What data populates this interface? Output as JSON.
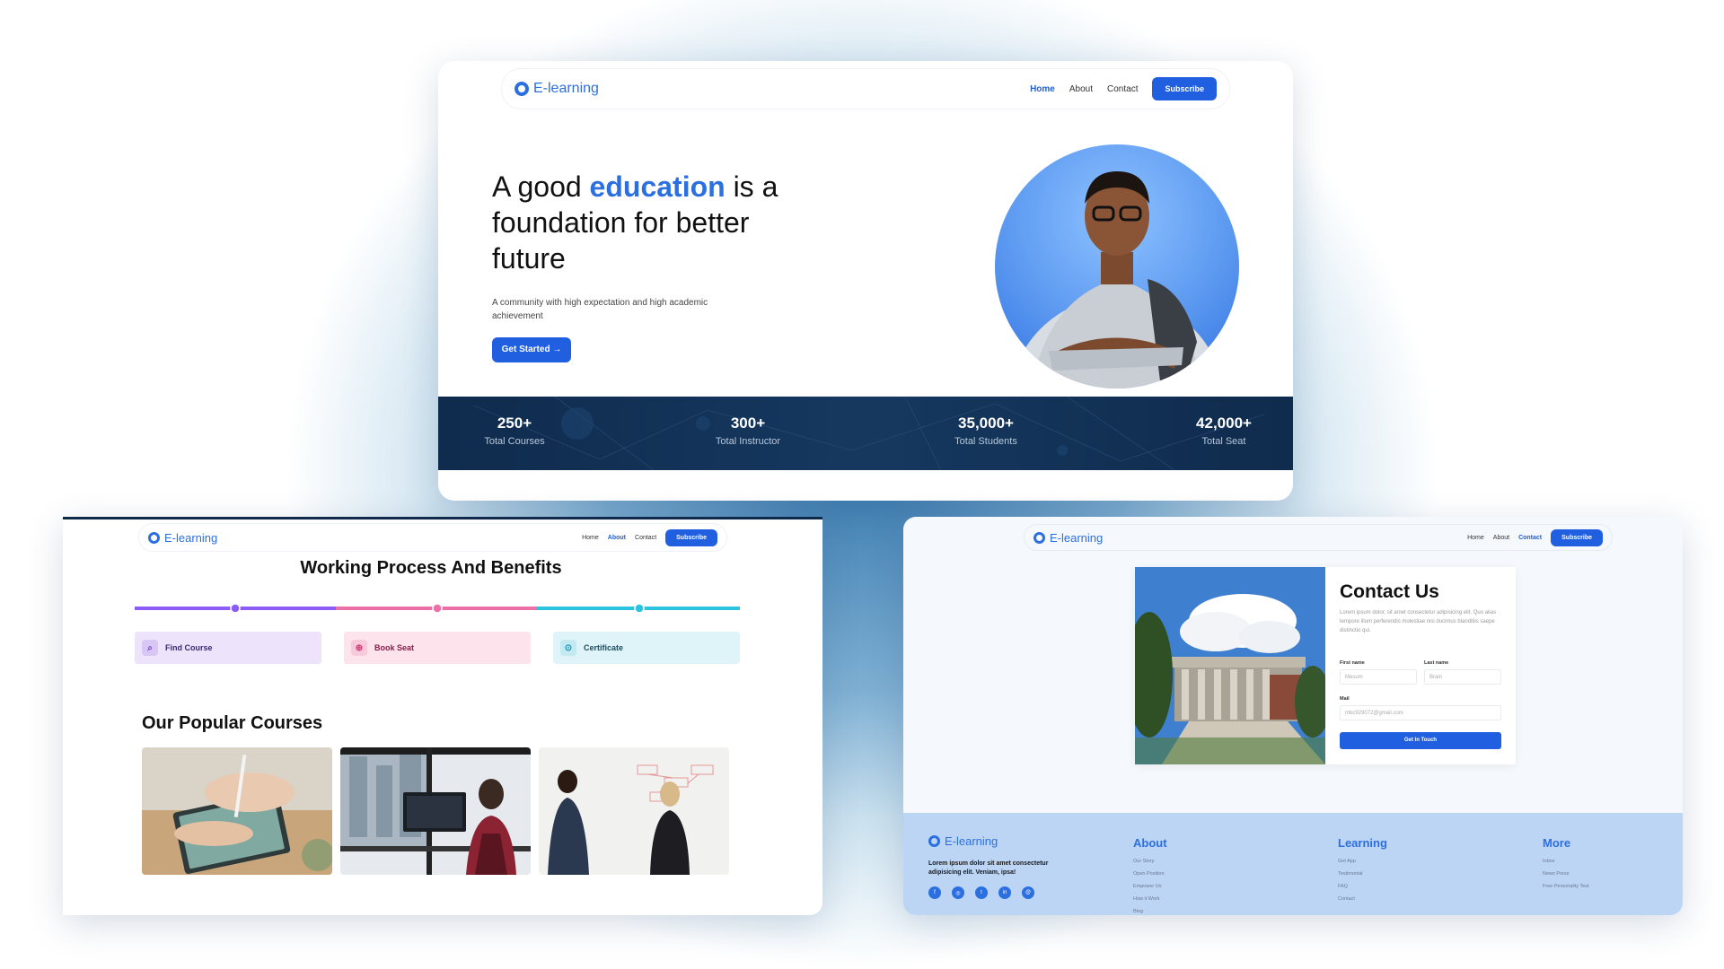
{
  "brand": "E-learning",
  "colors": {
    "accent": "#1f5fe0",
    "stats_bg": "#0f2b4d",
    "footer_bg": "#bcd5f5"
  },
  "hero_page": {
    "nav": [
      {
        "label": "Home",
        "active": true
      },
      {
        "label": "About",
        "active": false
      },
      {
        "label": "Contact",
        "active": false
      }
    ],
    "subscribe": "Subscribe",
    "title_pre": "A good ",
    "title_highlight": "education",
    "title_post": " is a foundation for better future",
    "subtitle": "A community with high expectation and high academic achievement",
    "cta": "Get Started →",
    "stats": [
      {
        "value": "250+",
        "label": "Total Courses"
      },
      {
        "value": "300+",
        "label": "Total Instructor"
      },
      {
        "value": "35,000+",
        "label": "Total Students"
      },
      {
        "value": "42,000+",
        "label": "Total Seat"
      }
    ]
  },
  "about_page": {
    "nav": [
      {
        "label": "Home",
        "active": false
      },
      {
        "label": "About",
        "active": true
      },
      {
        "label": "Contact",
        "active": false
      }
    ],
    "subscribe": "Subscribe",
    "section_title": "Working Process And Benefits",
    "steps": [
      {
        "label": "Find Course",
        "icon": "search-icon"
      },
      {
        "label": "Book Seat",
        "icon": "plus-circle-icon"
      },
      {
        "label": "Certificate",
        "icon": "badge-icon"
      }
    ],
    "courses_title": "Our Popular Courses"
  },
  "contact_page": {
    "nav": [
      {
        "label": "Home",
        "active": false
      },
      {
        "label": "About",
        "active": false
      },
      {
        "label": "Contact",
        "active": true
      }
    ],
    "subscribe": "Subscribe",
    "title": "Contact Us",
    "description": "Lorem ipsum dolor, sit amet consectetur adipisicing elit. Quo alias tempore illum perferendis molestiae nisi ducimus blanditiis saepe distinctio qui.",
    "first_name_label": "First name",
    "first_name_placeholder": "Mesum",
    "last_name_label": "Last name",
    "last_name_placeholder": "Brain",
    "mail_label": "Mail",
    "mail_placeholder": "mbc929072@gmail.com",
    "submit": "Get In Touch",
    "footer": {
      "text": "Lorem ipsum dolor sit amet consectetur adipisicing elit. Veniam, ipsa!",
      "columns": [
        {
          "title": "About",
          "items": [
            "Our Story",
            "Open Position",
            "Empower Us",
            "How it Work",
            "Blog"
          ]
        },
        {
          "title": "Learning",
          "items": [
            "Get App",
            "Testimonial",
            "FAQ",
            "Contact"
          ]
        },
        {
          "title": "More",
          "items": [
            "Inbox",
            "News Press",
            "Free Personality Test"
          ]
        }
      ]
    }
  }
}
